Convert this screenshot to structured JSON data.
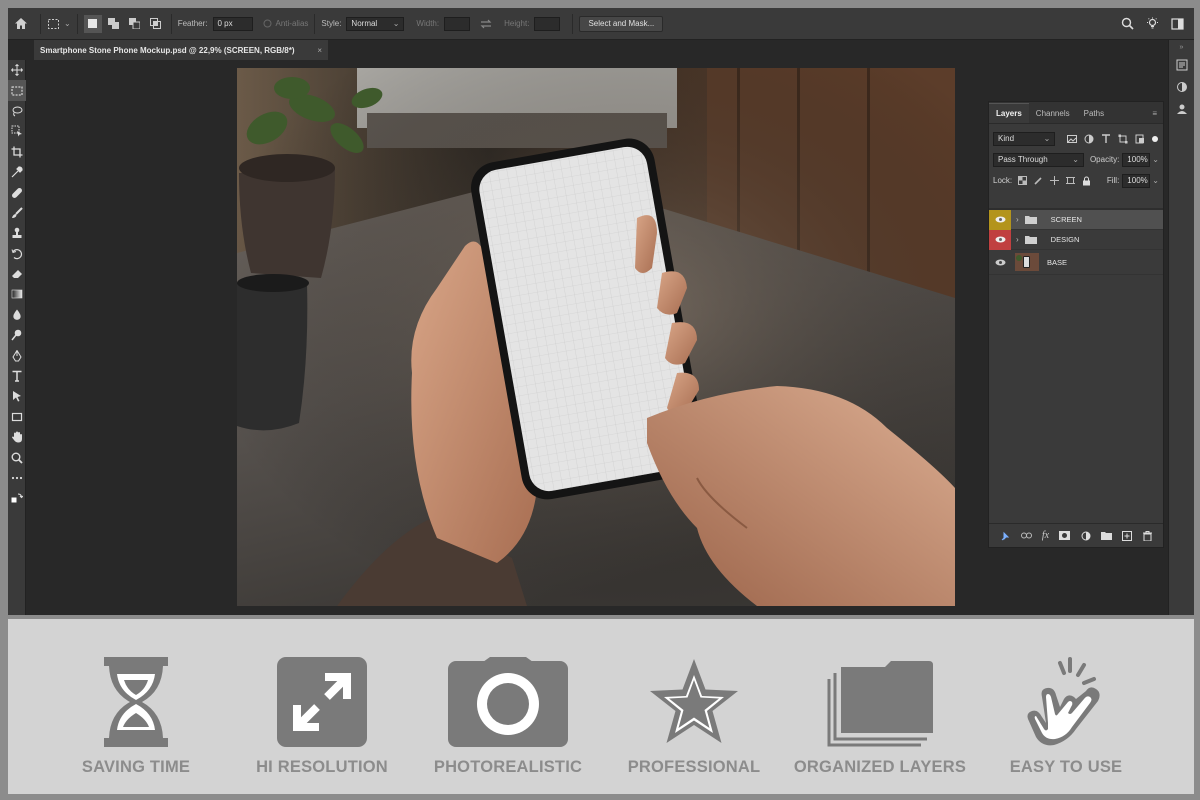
{
  "options_bar": {
    "feather_label": "Feather:",
    "feather_value": "0 px",
    "antialias_label": "Anti-alias",
    "style_label": "Style:",
    "style_value": "Normal",
    "width_label": "Width:",
    "height_label": "Height:",
    "select_mask_label": "Select and Mask..."
  },
  "document_tab": {
    "title": "Smartphone Stone Phone Mockup.psd @ 22,9% (SCREEN, RGB/8*)",
    "close": "×"
  },
  "layers_panel": {
    "tabs": [
      "Layers",
      "Channels",
      "Paths"
    ],
    "filter_kind": "Kind",
    "blend_mode": "Pass Through",
    "opacity_label": "Opacity:",
    "opacity_value": "100%",
    "lock_label": "Lock:",
    "fill_label": "Fill:",
    "fill_value": "100%",
    "layers": [
      {
        "name": "SCREEN",
        "type": "group",
        "color": "#b3941c"
      },
      {
        "name": "DESIGN",
        "type": "group",
        "color": "#c04040"
      },
      {
        "name": "BASE",
        "type": "image",
        "color": ""
      }
    ]
  },
  "features": [
    {
      "label": "SAVING TIME",
      "icon": "hourglass-icon"
    },
    {
      "label": "HI RESOLUTION",
      "icon": "expand-icon"
    },
    {
      "label": "PHOTOREALISTIC",
      "icon": "camera-icon"
    },
    {
      "label": "PROFESSIONAL",
      "icon": "star-icon"
    },
    {
      "label": "ORGANIZED LAYERS",
      "icon": "folder-stack-icon"
    },
    {
      "label": "EASY TO USE",
      "icon": "tap-hand-icon"
    }
  ],
  "colors": {
    "app_bg": "#282828",
    "panel_bg": "#3a3a3a",
    "band_bg": "#d3d3d3",
    "icon_gray": "#7a7a7a",
    "label_gray": "#8c8c8c"
  }
}
